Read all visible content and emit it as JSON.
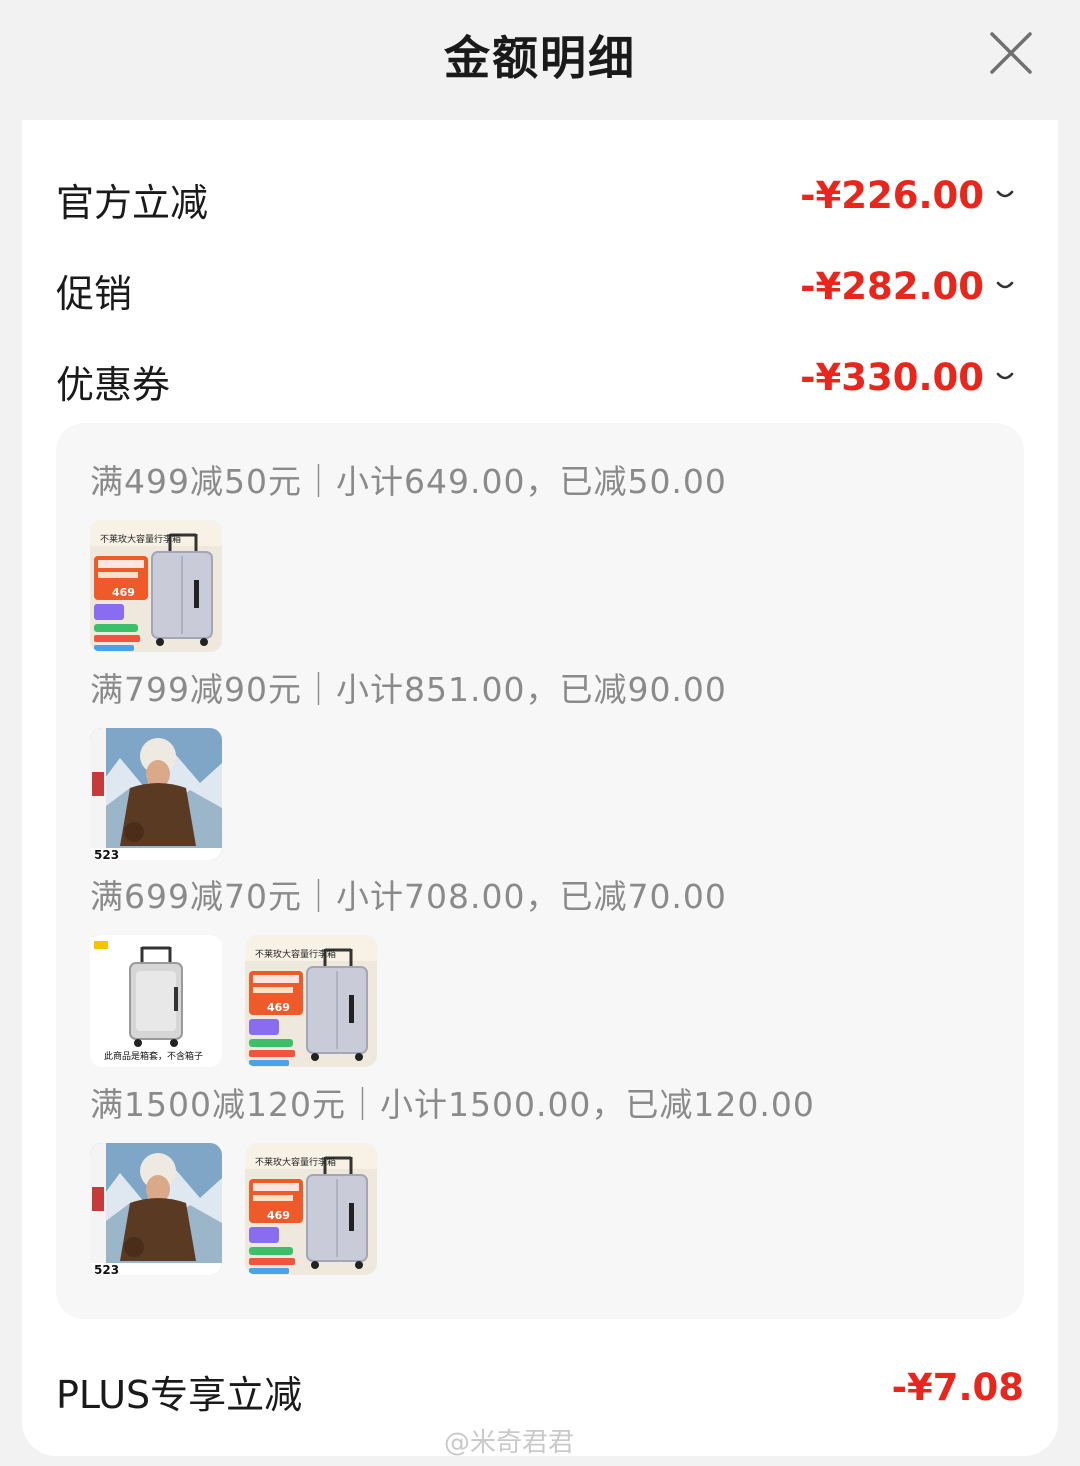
{
  "header": {
    "title": "金额明细",
    "close_icon": "close-icon"
  },
  "discounts": [
    {
      "label": "官方立减",
      "amount": "-¥226.00"
    },
    {
      "label": "促销",
      "amount": "-¥282.00"
    },
    {
      "label": "优惠券",
      "amount": "-¥330.00"
    }
  ],
  "coupon_groups": [
    {
      "rule": "满499减50元｜小计649.00，已减50.00",
      "products": [
        "suitcase-ad"
      ]
    },
    {
      "rule": "满799减90元｜小计851.00，已减90.00",
      "products": [
        "down-jacket"
      ]
    },
    {
      "rule": "满699减70元｜小计708.00，已减70.00",
      "products": [
        "suitcase-cover",
        "suitcase-ad"
      ]
    },
    {
      "rule": "满1500减120元｜小计1500.00，已减120.00",
      "products": [
        "down-jacket",
        "suitcase-ad"
      ]
    }
  ],
  "product_images": {
    "suitcase_ad": {
      "headline": "不莱玫大容量行李箱",
      "price": "469"
    },
    "down_jacket": {
      "price": "523"
    },
    "suitcase_cover": {
      "caption": "此商品是箱套，不含箱子"
    }
  },
  "plus": {
    "label": "PLUS专享立减",
    "amount": "-¥7.08"
  },
  "watermark": "@米奇君君",
  "colors": {
    "accent": "#e8261c",
    "background": "#f2f2f2",
    "panel": "#f7f7f7"
  }
}
